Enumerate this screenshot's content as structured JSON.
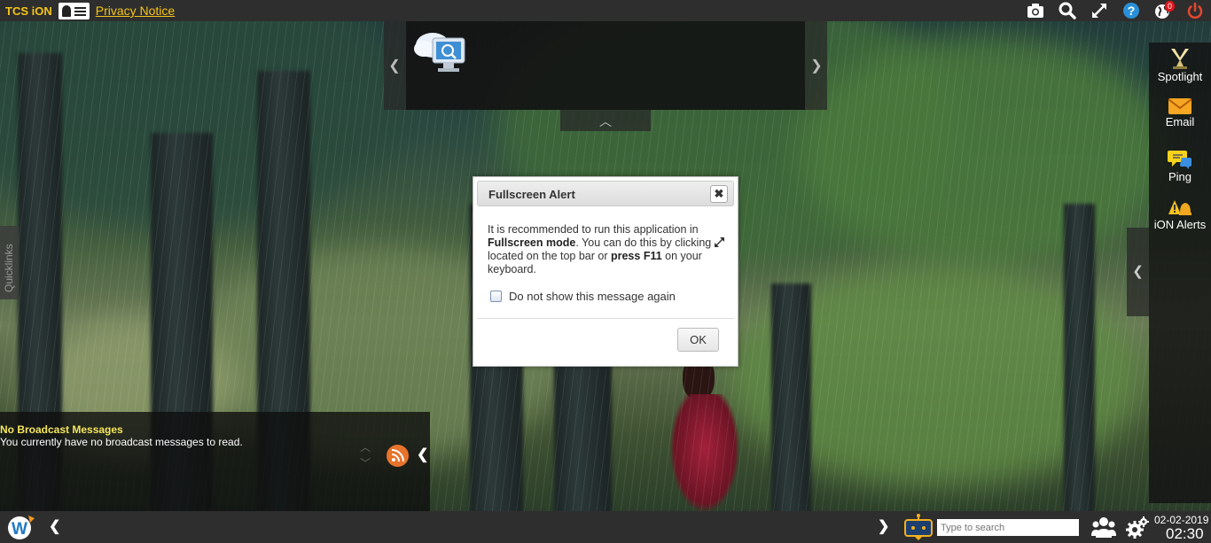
{
  "topbar": {
    "brand": "TCS iON",
    "privacy_label": "Privacy Notice",
    "icons": [
      "camera-icon",
      "search-icon",
      "fullscreen-icon",
      "help-icon",
      "globe-icon",
      "power-icon"
    ],
    "notification_count": "0"
  },
  "quicklinks": {
    "label": "Quicklinks"
  },
  "right_panel": {
    "items": [
      {
        "label": "Spotlight",
        "icon": "spotlight-icon"
      },
      {
        "label": "Email",
        "icon": "envelope-icon"
      },
      {
        "label": "Ping",
        "icon": "chat-bubble-icon"
      },
      {
        "label": "iON Alerts",
        "icon": "alert-bell-icon"
      }
    ]
  },
  "broadcast": {
    "title": "No Broadcast Messages",
    "message": "You currently have no broadcast messages to read."
  },
  "dialog": {
    "title": "Fullscreen Alert",
    "close_glyph": "✖",
    "text_1": "It is recommended to run this application in ",
    "text_bold_1": "Fullscreen mode",
    "text_2": ". You can do this by clicking ",
    "text_3": " located on the top bar or ",
    "text_bold_2": "press F11",
    "text_4": " on your keyboard.",
    "checkbox_label": "Do not show this message again",
    "ok_label": "OK"
  },
  "bottombar": {
    "search_placeholder": "Type to search",
    "date": "02-02-2019",
    "time": "02:30"
  },
  "colors": {
    "bar": "#2e2e2e",
    "brand_yellow": "#f5c518",
    "broadcast_title": "#f5e65c",
    "rss_orange": "#e8732b",
    "help_blue": "#2a8fd8",
    "power_red": "#e5472f"
  }
}
